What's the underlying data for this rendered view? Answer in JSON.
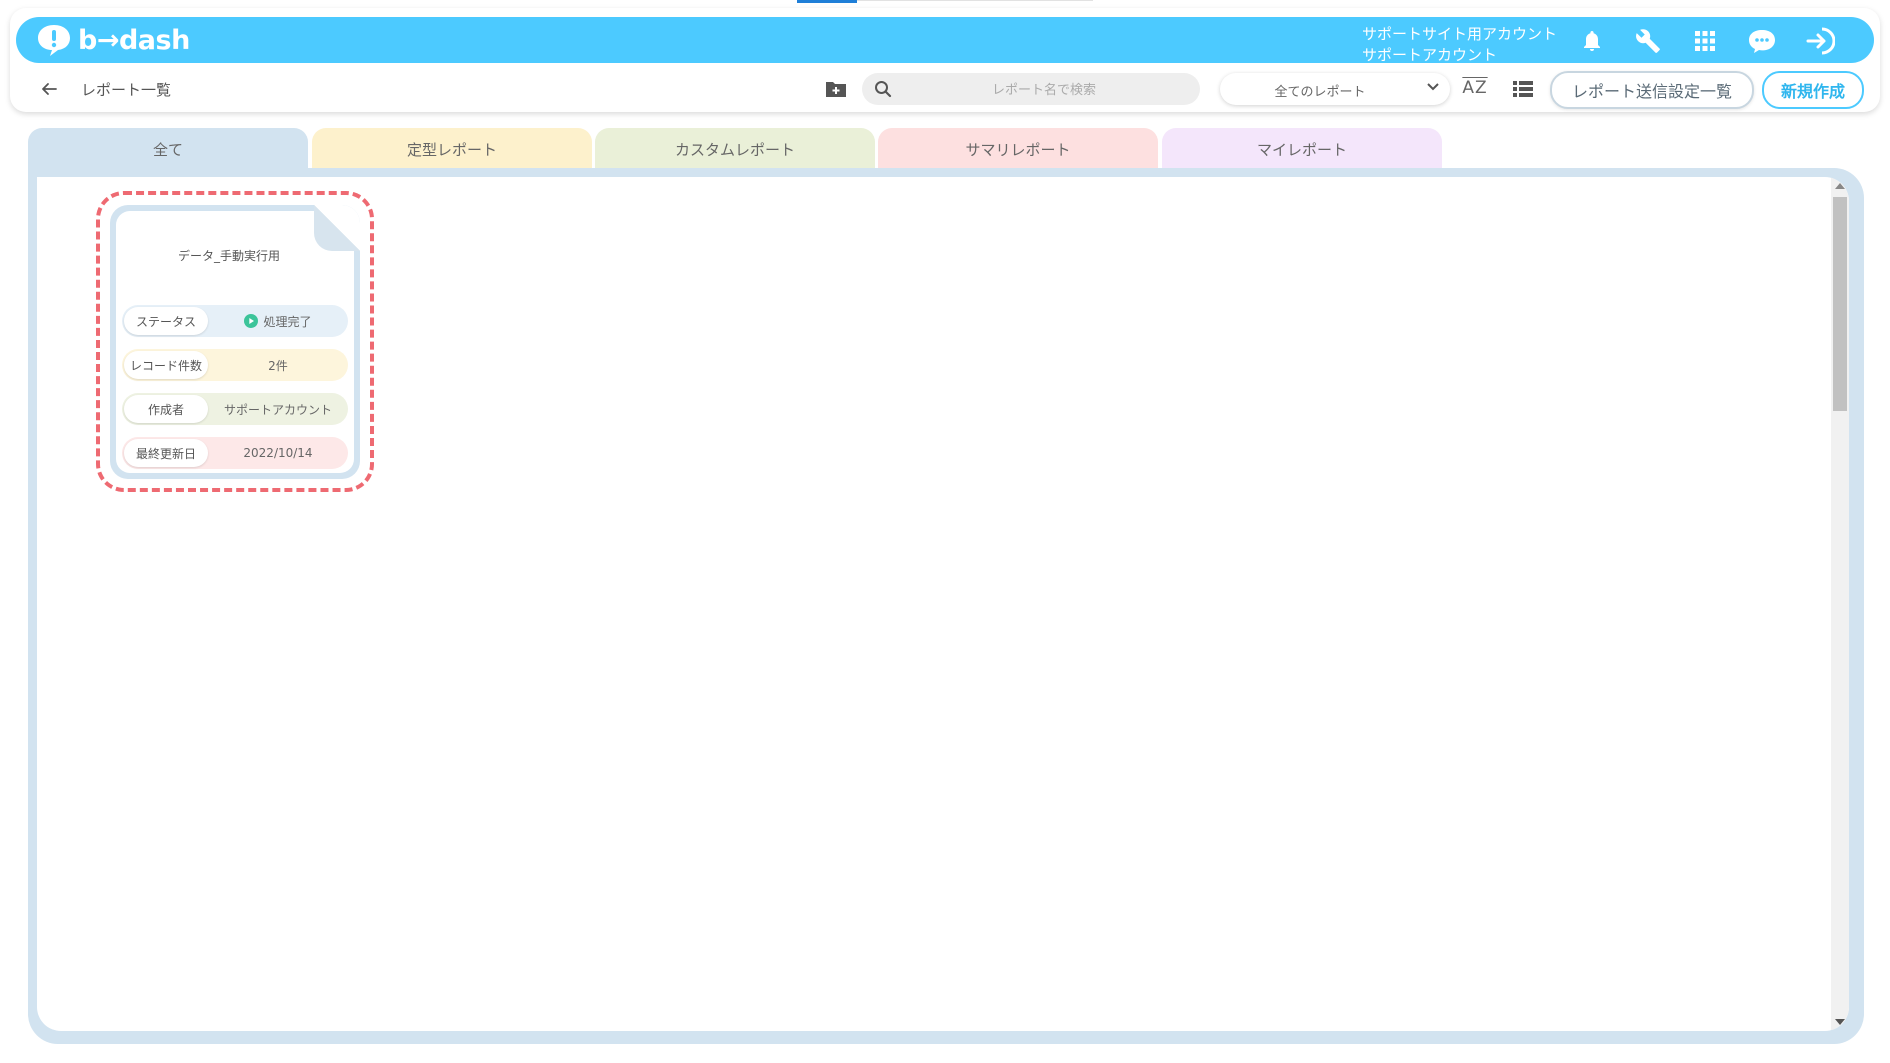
{
  "app": {
    "logo_text": "b→dash"
  },
  "header": {
    "account_line1": "サポートサイト用アカウント",
    "account_line2": "サポートアカウント",
    "icons": [
      "bell-icon",
      "wrench-icon",
      "grid-icon",
      "chat-icon",
      "logout-icon"
    ]
  },
  "toolbar": {
    "page_title": "レポート一覧",
    "search_placeholder": "レポート名で検索",
    "filter_selected": "全てのレポート",
    "sort_label": "AZ",
    "send_settings_label": "レポート送信設定一覧",
    "new_label": "新規作成"
  },
  "tabs": [
    {
      "label": "全て",
      "color": "#d2e3f0"
    },
    {
      "label": "定型レポート",
      "color": "#fdf1cc"
    },
    {
      "label": "カスタムレポート",
      "color": "#eaf0d8"
    },
    {
      "label": "サマリレポート",
      "color": "#fde0e0"
    },
    {
      "label": "マイレポート",
      "color": "#f4e6fb"
    }
  ],
  "report_card": {
    "title": "データ_手動実行用",
    "rows": [
      {
        "label": "ステータス",
        "value": "処理完了",
        "color": "#e6f0f8"
      },
      {
        "label": "レコード件数",
        "value": "2件",
        "color": "#fdf5dc"
      },
      {
        "label": "作成者",
        "value": "サポートアカウント",
        "color": "#eef2e2"
      },
      {
        "label": "最終更新日",
        "value": "2022/10/14",
        "color": "#fde8e8"
      }
    ]
  },
  "colors": {
    "brand": "#4ccaff",
    "highlight": "#ee6a72",
    "status_ok": "#3cc49a"
  }
}
